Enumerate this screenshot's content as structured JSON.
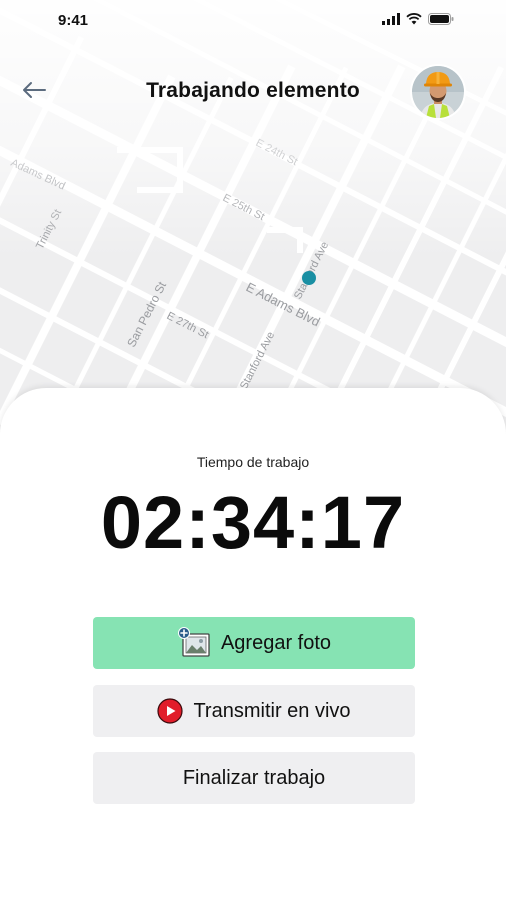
{
  "status_bar": {
    "time": "9:41"
  },
  "header": {
    "title": "Trabajando elemento",
    "back_icon": "arrow-left-icon",
    "avatar_icon": "worker-avatar"
  },
  "map": {
    "streets": [
      "E 24th St",
      "E 25th St",
      "E 27th St",
      "E Adams Blvd",
      "Adams Blvd",
      "Trinity St",
      "San Pedro St",
      "Stanford Ave",
      "Stanford Ave"
    ],
    "location_marker_color": "#1a8fa3"
  },
  "timer": {
    "label": "Tiempo de trabajo",
    "value": "02:34:17"
  },
  "actions": {
    "add_photo": {
      "label": "Agregar foto",
      "icon": "add-photo-icon",
      "color": "#86e3b3"
    },
    "live_stream": {
      "label": "Transmitir en vivo",
      "icon": "play-circle-icon",
      "color": "#efeff1"
    },
    "finish": {
      "label": "Finalizar trabajo",
      "color": "#efeff1"
    }
  }
}
